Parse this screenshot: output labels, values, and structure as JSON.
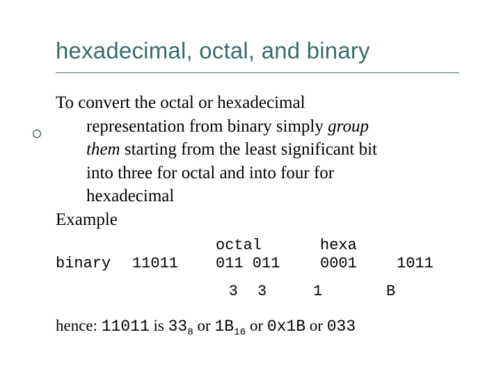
{
  "title": "hexadecimal, octal, and binary",
  "intro_l1": "To convert the octal or hexadecimal",
  "intro_l2a": "representation from binary simply ",
  "intro_l2b_italic": "group",
  "intro_l3a_italic": "them",
  "intro_l3b": " starting from the least significant bit",
  "intro_l4": "into three for octal and  into four for",
  "intro_l5": "hexadecimal",
  "example_label": "Example",
  "r1": {
    "a": "",
    "b": "",
    "c": "octal",
    "d": "hexa",
    "e": ""
  },
  "r2": {
    "a": "binary",
    "b": "11011",
    "c": "011 011",
    "d": "0001",
    "e": "1011"
  },
  "vals": {
    "v1": "3",
    "v2": "3",
    "v3": "1",
    "v4": "B"
  },
  "hence_prefix": "hence: ",
  "hence_bin": "11011",
  "hence_is": " is ",
  "oct_main": "33",
  "oct_sub": "8",
  "hence_or1": " or ",
  "hex_main": "1B",
  "hex_sub": "16",
  "hence_or2": " or ",
  "hex_c": "0x1B",
  "hence_or3": " or ",
  "oct_c": "033"
}
